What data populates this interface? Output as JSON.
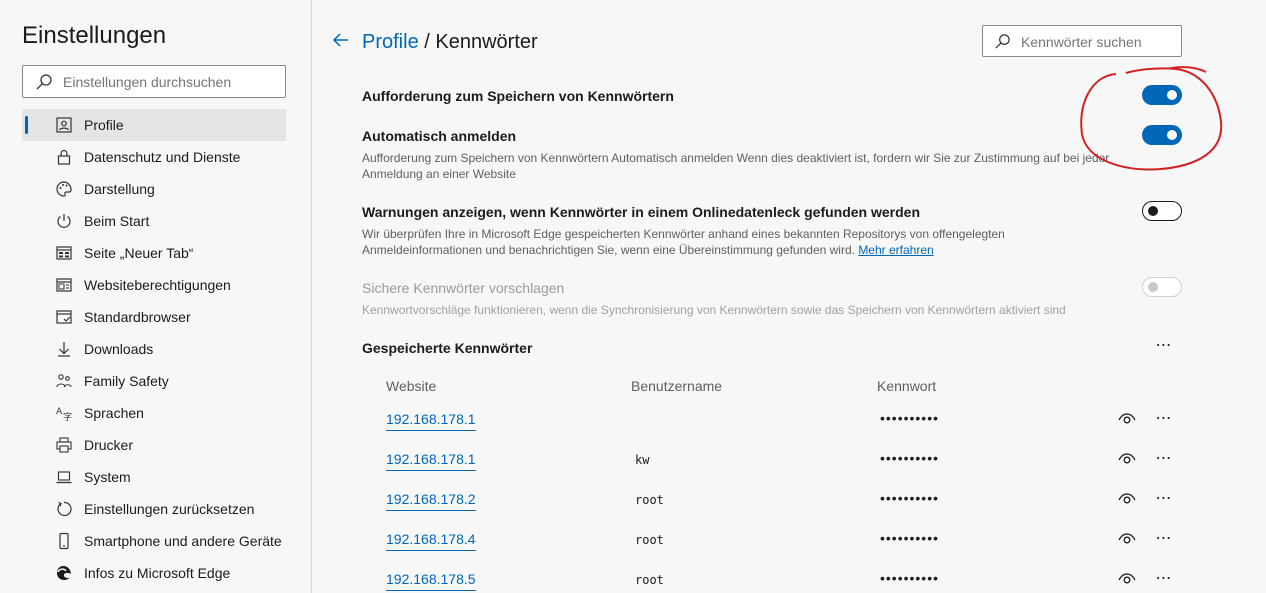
{
  "sidebar": {
    "title": "Einstellungen",
    "search_placeholder": "Einstellungen durchsuchen",
    "items": [
      {
        "label": "Profile",
        "icon": "profile-icon"
      },
      {
        "label": "Datenschutz und Dienste",
        "icon": "lock-icon"
      },
      {
        "label": "Darstellung",
        "icon": "palette-icon"
      },
      {
        "label": "Beim Start",
        "icon": "power-icon"
      },
      {
        "label": "Seite „Neuer Tab“",
        "icon": "new-tab-icon"
      },
      {
        "label": "Websiteberechtigungen",
        "icon": "site-permissions-icon"
      },
      {
        "label": "Standardbrowser",
        "icon": "default-browser-icon"
      },
      {
        "label": "Downloads",
        "icon": "download-icon"
      },
      {
        "label": "Family Safety",
        "icon": "family-icon"
      },
      {
        "label": "Sprachen",
        "icon": "language-icon"
      },
      {
        "label": "Drucker",
        "icon": "printer-icon"
      },
      {
        "label": "System",
        "icon": "laptop-icon"
      },
      {
        "label": "Einstellungen zurücksetzen",
        "icon": "reset-icon"
      },
      {
        "label": "Smartphone und andere Geräte",
        "icon": "phone-icon"
      },
      {
        "label": "Infos zu Microsoft Edge",
        "icon": "edge-logo-icon"
      }
    ]
  },
  "header": {
    "breadcrumb_parent": "Profile",
    "breadcrumb_sep": "/",
    "breadcrumb_current": "Kennwörter",
    "search_placeholder": "Kennwörter suchen"
  },
  "settings": [
    {
      "title": "Aufforderung zum Speichern von Kennwörtern",
      "desc": "",
      "state": "on"
    },
    {
      "title": "Automatisch anmelden",
      "desc": "Aufforderung zum Speichern von Kennwörtern Automatisch anmelden Wenn dies deaktiviert ist, fordern wir Sie zur Zustimmung auf bei jeder Anmeldung an einer Website",
      "state": "on"
    },
    {
      "title": "Warnungen anzeigen, wenn Kennwörter in einem Onlinedatenleck gefunden werden",
      "desc": "Wir überprüfen Ihre in Microsoft Edge gespeicherten Kennwörter anhand eines bekannten Repositorys von offengelegten Anmeldeinformationen und benachrichtigen Sie, wenn eine Übereinstimmung gefunden wird.",
      "link": "Mehr erfahren",
      "state": "off"
    },
    {
      "title": "Sichere Kennwörter vorschlagen",
      "desc": "Kennwortvorschläge funktionieren, wenn die Synchronisierung von Kennwörtern sowie das Speichern von Kennwörtern aktiviert sind",
      "state": "disabled"
    }
  ],
  "saved": {
    "title": "Gespeicherte Kennwörter",
    "more": "⋯",
    "columns": [
      "Website",
      "Benutzername",
      "Kennwort"
    ],
    "rows": [
      {
        "site": "192.168.178.1",
        "user": "",
        "pass": "••••••••••"
      },
      {
        "site": "192.168.178.1",
        "user": "kw",
        "pass": "••••••••••"
      },
      {
        "site": "192.168.178.2",
        "user": "root",
        "pass": "••••••••••"
      },
      {
        "site": "192.168.178.4",
        "user": "root",
        "pass": "••••••••••"
      },
      {
        "site": "192.168.178.5",
        "user": "root",
        "pass": "••••••••••"
      }
    ]
  },
  "colors": {
    "accent": "#0067b8",
    "annotation": "#d42020"
  }
}
